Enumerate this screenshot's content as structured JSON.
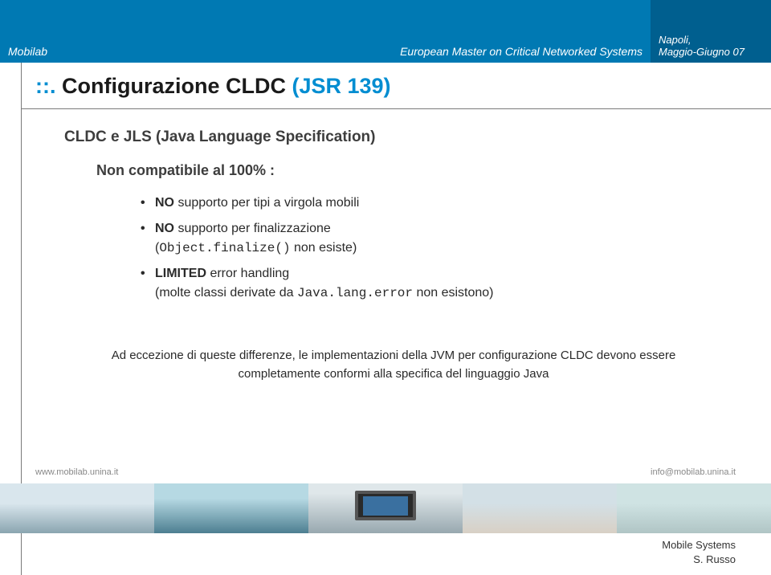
{
  "header": {
    "left": "Mobilab",
    "center": "European Master on Critical Networked Systems",
    "right_line1": "Napoli,",
    "right_line2": "Maggio-Giugno 07"
  },
  "title": {
    "dots": "::.",
    "black": " Configurazione CLDC ",
    "blue": "(JSR 139)"
  },
  "content": {
    "subtitle": "CLDC e JLS (Java Language Specification)",
    "compat": "Non compatibile al 100% :",
    "b1_bold": "NO",
    "b1_rest": " supporto per tipi a virgola mobili",
    "b2_bold": "NO",
    "b2_rest": " supporto per finalizzazione",
    "b2_sub_open": "(",
    "b2_mono": "Object.finalize()",
    "b2_sub_close": " non esiste)",
    "b3_bold": "LIMITED",
    "b3_rest": " error handling",
    "b3_sub_open": "(molte classi derivate da ",
    "b3_mono": "Java.lang.error",
    "b3_sub_close": " non esistono)",
    "note": "Ad eccezione di queste differenze, le implementazioni della JVM per configurazione CLDC devono essere completamente conformi alla specifica del linguaggio Java"
  },
  "footer": {
    "left": "www.mobilab.unina.it",
    "right": "info@mobilab.unina.it",
    "bottom1": "Mobile Systems",
    "bottom2": "S. Russo"
  }
}
